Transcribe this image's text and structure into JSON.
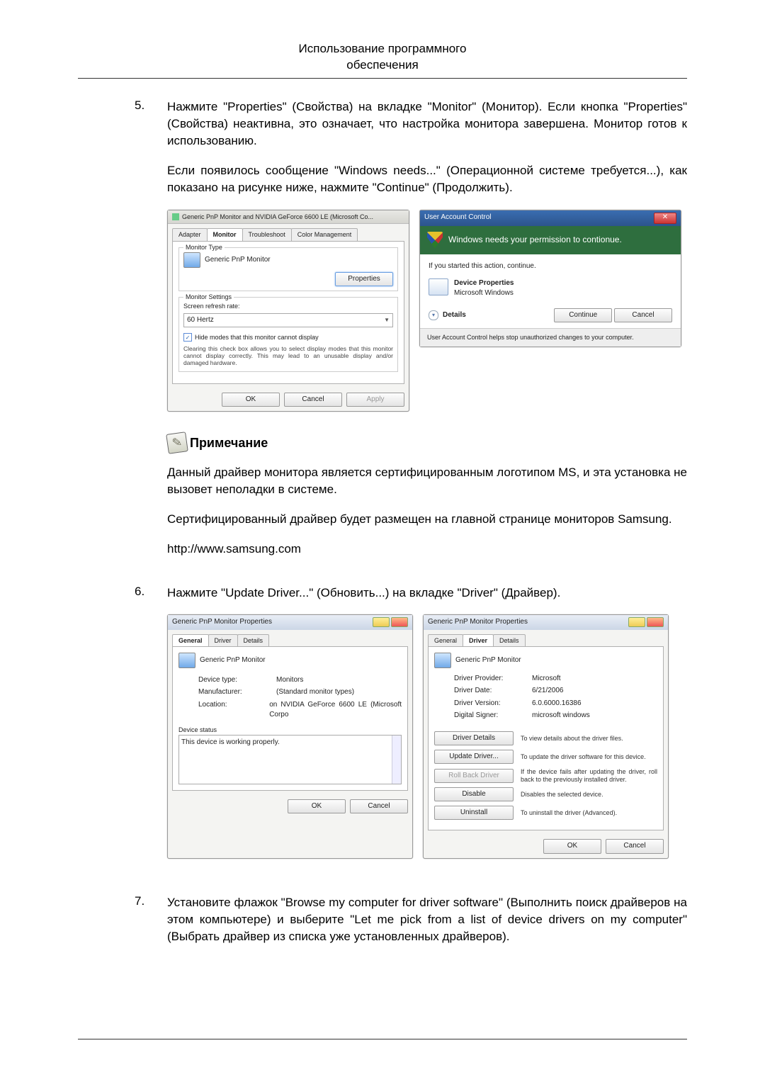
{
  "header": {
    "line1": "Использование программного",
    "line2": "обеспечения"
  },
  "steps": [
    {
      "num": "5.",
      "paras": [
        "Нажмите \"Properties\" (Свойства) на вкладке \"Monitor\" (Монитор). Если кнопка \"Properties\" (Свойства) неактивна, это означает, что настройка монитора завершена. Монитор готов к использованию.",
        "Если появилось сообщение \"Windows needs...\" (Операционной системе требуется...), как показано на рисунке ниже, нажмите \"Continue\" (Продолжить)."
      ]
    },
    {
      "num": "6.",
      "paras": [
        "Нажмите \"Update Driver...\" (Обновить...) на вкладке \"Driver\" (Драйвер)."
      ]
    },
    {
      "num": "7.",
      "paras": [
        "Установите флажок \"Browse my computer for driver software\" (Выполнить поиск драйверов на этом компьютере) и выберите \"Let me pick from a list of device drivers on my computer\" (Выбрать драйвер из списка уже установленных драйверов)."
      ]
    }
  ],
  "note": {
    "heading": "Примечание",
    "paras": [
      "Данный драйвер монитора является сертифицированным логотипом MS, и эта установка не вызовет неполадки в системе.",
      "Сертифицированный драйвер будет размещен на главной странице мониторов Samsung.",
      "http://www.samsung.com"
    ]
  },
  "monitor_dialog": {
    "title": "Generic PnP Monitor and NVIDIA GeForce 6600 LE (Microsoft Co...",
    "tabs": [
      "Adapter",
      "Monitor",
      "Troubleshoot",
      "Color Management"
    ],
    "group_type": "Monitor Type",
    "monitor_name": "Generic PnP Monitor",
    "properties_btn": "Properties",
    "group_settings": "Monitor Settings",
    "refresh_label": "Screen refresh rate:",
    "refresh_value": "60 Hertz",
    "hide_checkbox": "Hide modes that this monitor cannot display",
    "hide_desc": "Clearing this check box allows you to select display modes that this monitor cannot display correctly. This may lead to an unusable display and/or damaged hardware.",
    "ok": "OK",
    "cancel": "Cancel",
    "apply": "Apply"
  },
  "uac_dialog": {
    "title": "User Account Control",
    "banner": "Windows needs your permission to contionue.",
    "if_started": "If you started this action, continue.",
    "prop_title": "Device Properties",
    "prop_pub": "Microsoft Windows",
    "details": "Details",
    "continue": "Continue",
    "cancel": "Cancel",
    "footer": "User Account Control helps stop unauthorized changes to your computer."
  },
  "general_dialog": {
    "title": "Generic PnP Monitor Properties",
    "tabs": [
      "General",
      "Driver",
      "Details"
    ],
    "name": "Generic PnP Monitor",
    "kv": [
      [
        "Device type:",
        "Monitors"
      ],
      [
        "Manufacturer:",
        "(Standard monitor types)"
      ],
      [
        "Location:",
        "on NVIDIA GeForce 6600 LE (Microsoft Corpo"
      ]
    ],
    "status_label": "Device status",
    "status_text": "This device is working properly.",
    "ok": "OK",
    "cancel": "Cancel"
  },
  "driver_dialog": {
    "title": "Generic PnP Monitor Properties",
    "tabs": [
      "General",
      "Driver",
      "Details"
    ],
    "name": "Generic PnP Monitor",
    "kv": [
      [
        "Driver Provider:",
        "Microsoft"
      ],
      [
        "Driver Date:",
        "6/21/2006"
      ],
      [
        "Driver Version:",
        "6.0.6000.16386"
      ],
      [
        "Digital Signer:",
        "microsoft windows"
      ]
    ],
    "rows": [
      [
        "Driver Details",
        "To view details about the driver files."
      ],
      [
        "Update Driver...",
        "To update the driver software for this device."
      ],
      [
        "Roll Back Driver",
        "If the device fails after updating the driver, roll back to the previously installed driver."
      ],
      [
        "Disable",
        "Disables the selected device."
      ],
      [
        "Uninstall",
        "To uninstall the driver (Advanced)."
      ]
    ],
    "ok": "OK",
    "cancel": "Cancel"
  }
}
